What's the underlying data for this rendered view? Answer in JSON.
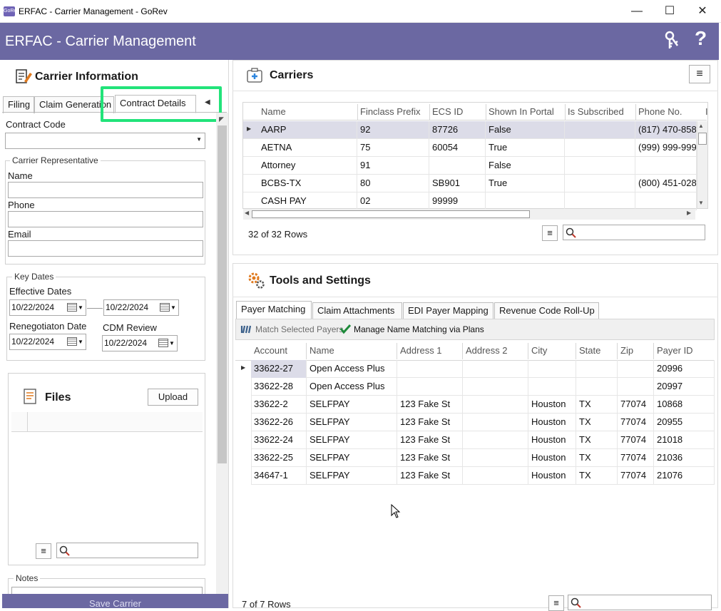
{
  "window": {
    "icon_text": "GoRev",
    "title": "ERFAC - Carrier Management - GoRev",
    "minimize": "—",
    "maximize": "☐",
    "close": "✕"
  },
  "header": {
    "title": "ERFAC - Carrier Management",
    "help": "?"
  },
  "carrier_info": {
    "title": "Carrier Information",
    "tabs": [
      "Filing",
      "Claim Generation",
      "Contract Details"
    ],
    "tab_nav_left": "◀",
    "contract_code_label": "Contract Code",
    "contract_code_value": "",
    "rep_group": "Carrier Representative",
    "name_label": "Name",
    "phone_label": "Phone",
    "email_label": "Email",
    "key_dates_group": "Key Dates",
    "effective_label": "Effective Dates",
    "effective_from": "10/22/2024",
    "effective_to": "10/22/2024",
    "reneg_label": "Renegotiaton Date",
    "reneg_value": "10/22/2024",
    "cdm_label": "CDM Review",
    "cdm_value": "10/22/2024",
    "files_title": "Files",
    "upload_label": "Upload",
    "notes_group": "Notes",
    "save_label": "Save Carrier"
  },
  "carriers": {
    "title": "Carriers",
    "columns": [
      "Name",
      "Finclass Prefix",
      "ECS ID",
      "Shown In Portal",
      "Is Subscribed",
      "Phone No.",
      "I"
    ],
    "rows": [
      [
        "AARP",
        "92",
        "87726",
        "False",
        "",
        "(817) 470-858"
      ],
      [
        "AETNA",
        "75",
        "60054",
        "True",
        "",
        "(999) 999-999"
      ],
      [
        "Attorney",
        "91",
        "",
        "False",
        "",
        ""
      ],
      [
        "BCBS-TX",
        "80",
        "SB901",
        "True",
        "",
        "(800) 451-028"
      ],
      [
        "CASH PAY",
        "02",
        "99999",
        "",
        "",
        ""
      ]
    ],
    "row_count": "32 of 32 Rows",
    "search_value": ""
  },
  "tools": {
    "title": "Tools and Settings",
    "tabs": [
      "Payer Matching",
      "Claim Attachments",
      "EDI Payer Mapping",
      "Revenue Code Roll-Up"
    ],
    "match_selected": "Match Selected Payers",
    "manage_matching": "Manage Name Matching via Plans",
    "columns": [
      "Account",
      "Name",
      "Address 1",
      "Address 2",
      "City",
      "State",
      "Zip",
      "Payer ID"
    ],
    "rows": [
      [
        "33622-27",
        "Open Access Plus",
        "",
        "",
        "",
        "",
        "",
        "20996"
      ],
      [
        "33622-28",
        "Open Access Plus",
        "",
        "",
        "",
        "",
        "",
        "20997"
      ],
      [
        "33622-2",
        "SELFPAY",
        "123 Fake St",
        "",
        "Houston",
        "TX",
        "77074",
        "10868"
      ],
      [
        "33622-26",
        "SELFPAY",
        "123 Fake St",
        "",
        "Houston",
        "TX",
        "77074",
        "20955"
      ],
      [
        "33622-24",
        "SELFPAY",
        "123 Fake St",
        "",
        "Houston",
        "TX",
        "77074",
        "21018"
      ],
      [
        "33622-25",
        "SELFPAY",
        "123 Fake St",
        "",
        "Houston",
        "TX",
        "77074",
        "21036"
      ],
      [
        "34647-1",
        "SELFPAY",
        "123 Fake St",
        "",
        "Houston",
        "TX",
        "77074",
        "21076"
      ]
    ],
    "row_count": "7 of 7 Rows"
  },
  "colors": {
    "header_bg": "#6b68a2",
    "highlight_box": "#22e37a",
    "selected_row": "#dcdce8"
  }
}
